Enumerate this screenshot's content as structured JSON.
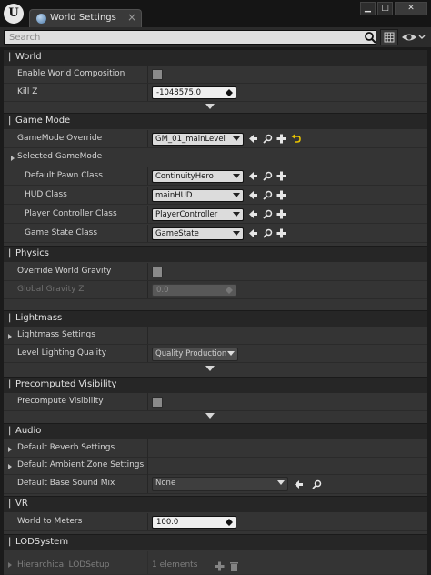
{
  "window": {
    "tab_title": "World Settings",
    "tab_close": "×",
    "logo_glyph": "U",
    "min_glyph": "▁",
    "max_glyph": "□",
    "close_glyph": "✕"
  },
  "search": {
    "placeholder": "Search"
  },
  "sections": {
    "world": {
      "title": "World",
      "enable_world_composition": {
        "label": "Enable World Composition",
        "checked": false
      },
      "kill_z": {
        "label": "Kill Z",
        "value": "-1048575.0"
      }
    },
    "game_mode": {
      "title": "Game Mode",
      "gamemode_override": {
        "label": "GameMode Override",
        "value": "GM_01_mainLevel"
      },
      "selected_gamemode": {
        "label": "Selected GameMode"
      },
      "default_pawn_class": {
        "label": "Default Pawn Class",
        "value": "ContinuityHero"
      },
      "hud_class": {
        "label": "HUD Class",
        "value": "mainHUD"
      },
      "player_controller_class": {
        "label": "Player Controller Class",
        "value": "PlayerController"
      },
      "game_state_class": {
        "label": "Game State Class",
        "value": "GameState"
      }
    },
    "physics": {
      "title": "Physics",
      "override_world_gravity": {
        "label": "Override World Gravity",
        "checked": false
      },
      "global_gravity_z": {
        "label": "Global Gravity Z",
        "value": "0.0"
      }
    },
    "lightmass": {
      "title": "Lightmass",
      "lightmass_settings": {
        "label": "Lightmass Settings"
      },
      "level_lighting_quality": {
        "label": "Level Lighting Quality",
        "value": "Quality Production"
      }
    },
    "precomputed_visibility": {
      "title": "Precomputed Visibility",
      "precompute_visibility": {
        "label": "Precompute Visibility",
        "checked": false
      }
    },
    "audio": {
      "title": "Audio",
      "default_reverb_settings": {
        "label": "Default Reverb Settings"
      },
      "default_ambient_zone_settings": {
        "label": "Default Ambient Zone Settings"
      },
      "default_base_sound_mix": {
        "label": "Default Base Sound Mix",
        "value": "None"
      }
    },
    "vr": {
      "title": "VR",
      "world_to_meters": {
        "label": "World to Meters",
        "value": "100.0"
      }
    },
    "lod_system": {
      "title": "LODSystem",
      "hierarchical_lod_setup": {
        "label": "Hierarchical LODSetup",
        "value": "1 elements"
      }
    }
  },
  "colors": {
    "accent_yellow": "#e8c300",
    "panel_bg": "#343434",
    "header_bg": "#262626"
  }
}
